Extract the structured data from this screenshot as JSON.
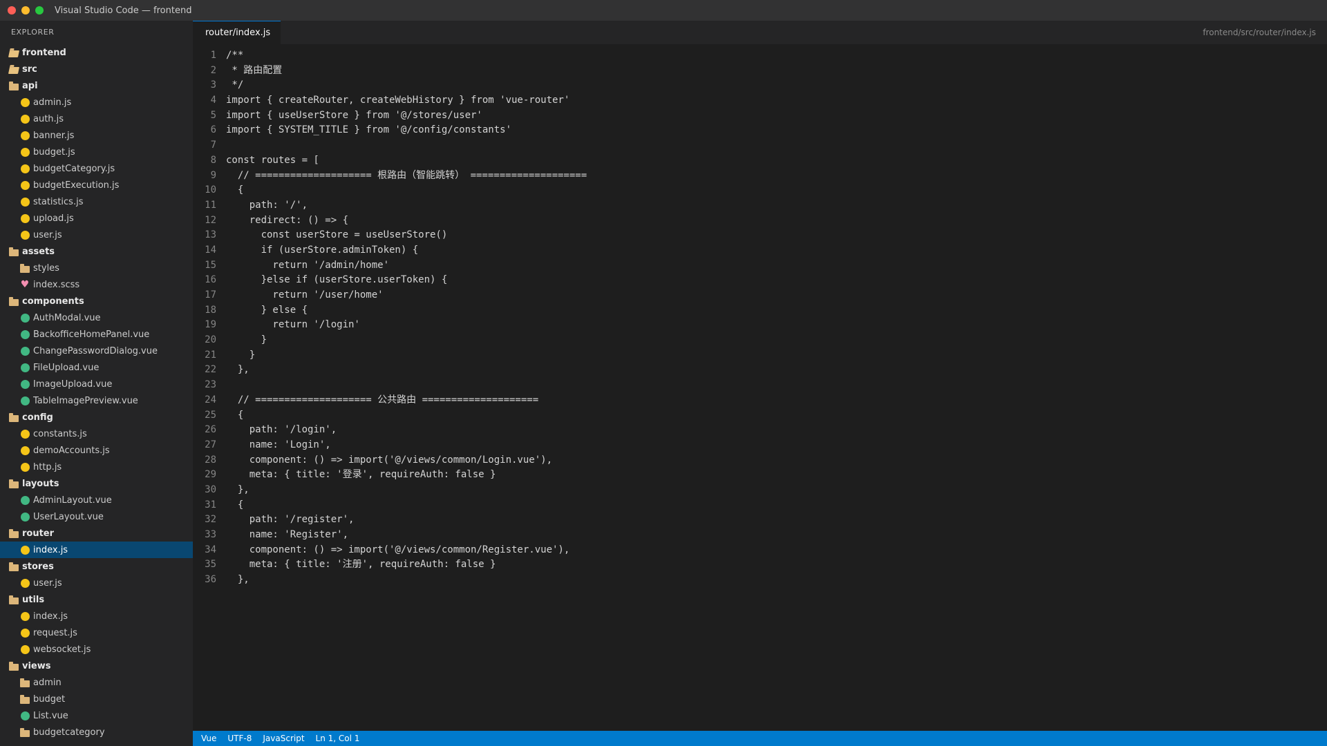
{
  "window": {
    "title": "Visual Studio Code — frontend"
  },
  "explorer": {
    "title": "EXPLORER",
    "items": [
      {
        "label": "frontend",
        "kind": "folder-open",
        "depth": 0,
        "bold": true
      },
      {
        "label": "src",
        "kind": "folder-open",
        "depth": 0,
        "bold": true
      },
      {
        "label": "api",
        "kind": "folder",
        "depth": 0,
        "bold": true
      },
      {
        "label": "admin.js",
        "kind": "js",
        "depth": 1
      },
      {
        "label": "auth.js",
        "kind": "js",
        "depth": 1
      },
      {
        "label": "banner.js",
        "kind": "js",
        "depth": 1
      },
      {
        "label": "budget.js",
        "kind": "js",
        "depth": 1
      },
      {
        "label": "budgetCategory.js",
        "kind": "js",
        "depth": 1
      },
      {
        "label": "budgetExecution.js",
        "kind": "js",
        "depth": 1
      },
      {
        "label": "statistics.js",
        "kind": "js",
        "depth": 1
      },
      {
        "label": "upload.js",
        "kind": "js",
        "depth": 1
      },
      {
        "label": "user.js",
        "kind": "js",
        "depth": 1
      },
      {
        "label": "assets",
        "kind": "folder",
        "depth": 0,
        "bold": true
      },
      {
        "label": "styles",
        "kind": "folder",
        "depth": 1
      },
      {
        "label": "index.scss",
        "kind": "scss",
        "depth": 1
      },
      {
        "label": "components",
        "kind": "folder",
        "depth": 0,
        "bold": true
      },
      {
        "label": "AuthModal.vue",
        "kind": "vue",
        "depth": 1
      },
      {
        "label": "BackofficeHomePanel.vue",
        "kind": "vue",
        "depth": 1
      },
      {
        "label": "ChangePasswordDialog.vue",
        "kind": "vue",
        "depth": 1
      },
      {
        "label": "FileUpload.vue",
        "kind": "vue",
        "depth": 1
      },
      {
        "label": "ImageUpload.vue",
        "kind": "vue",
        "depth": 1
      },
      {
        "label": "TableImagePreview.vue",
        "kind": "vue",
        "depth": 1
      },
      {
        "label": "config",
        "kind": "folder",
        "depth": 0,
        "bold": true
      },
      {
        "label": "constants.js",
        "kind": "js",
        "depth": 1
      },
      {
        "label": "demoAccounts.js",
        "kind": "js",
        "depth": 1
      },
      {
        "label": "http.js",
        "kind": "js",
        "depth": 1
      },
      {
        "label": "layouts",
        "kind": "folder",
        "depth": 0,
        "bold": true
      },
      {
        "label": "AdminLayout.vue",
        "kind": "vue",
        "depth": 1
      },
      {
        "label": "UserLayout.vue",
        "kind": "vue",
        "depth": 1
      },
      {
        "label": "router",
        "kind": "folder",
        "depth": 0,
        "bold": true
      },
      {
        "label": "index.js",
        "kind": "js",
        "depth": 1,
        "selected": true
      },
      {
        "label": "stores",
        "kind": "folder",
        "depth": 0,
        "bold": true
      },
      {
        "label": "user.js",
        "kind": "js",
        "depth": 1
      },
      {
        "label": "utils",
        "kind": "folder",
        "depth": 0,
        "bold": true
      },
      {
        "label": "index.js",
        "kind": "js",
        "depth": 1
      },
      {
        "label": "request.js",
        "kind": "js",
        "depth": 1
      },
      {
        "label": "websocket.js",
        "kind": "js",
        "depth": 1
      },
      {
        "label": "views",
        "kind": "folder",
        "depth": 0,
        "bold": true
      },
      {
        "label": "admin",
        "kind": "folder",
        "depth": 1
      },
      {
        "label": "budget",
        "kind": "folder",
        "depth": 1
      },
      {
        "label": "List.vue",
        "kind": "vue",
        "depth": 1
      },
      {
        "label": "budgetcategory",
        "kind": "folder",
        "depth": 1
      }
    ]
  },
  "tab": {
    "label": "router/index.js"
  },
  "breadcrumb": "frontend/src/router/index.js",
  "code": {
    "lines": [
      "/**",
      " * 路由配置",
      " */",
      "import { createRouter, createWebHistory } from 'vue-router'",
      "import { useUserStore } from '@/stores/user'",
      "import { SYSTEM_TITLE } from '@/config/constants'",
      "",
      "const routes = [",
      "  // ==================== 根路由（智能跳转） ====================",
      "  {",
      "    path: '/',",
      "    redirect: () => {",
      "      const userStore = useUserStore()",
      "      if (userStore.adminToken) {",
      "        return '/admin/home'",
      "      }else if (userStore.userToken) {",
      "        return '/user/home'",
      "      } else {",
      "        return '/login'",
      "      }",
      "    }",
      "  },",
      "",
      "  // ==================== 公共路由 ====================",
      "  {",
      "    path: '/login',",
      "    name: 'Login',",
      "    component: () => import('@/views/common/Login.vue'),",
      "    meta: { title: '登录', requireAuth: false }",
      "  },",
      "  {",
      "    path: '/register',",
      "    name: 'Register',",
      "    component: () => import('@/views/common/Register.vue'),",
      "    meta: { title: '注册', requireAuth: false }",
      "  },"
    ]
  },
  "status": {
    "language_mode": "Vue",
    "encoding": "UTF-8",
    "file_type": "JavaScript",
    "cursor": "Ln 1, Col 1"
  },
  "colors": {
    "accent": "#007acc",
    "selection": "#094771",
    "js_icon": "#f5c518",
    "vue_icon": "#41b883",
    "folder_icon": "#dcb67a"
  }
}
